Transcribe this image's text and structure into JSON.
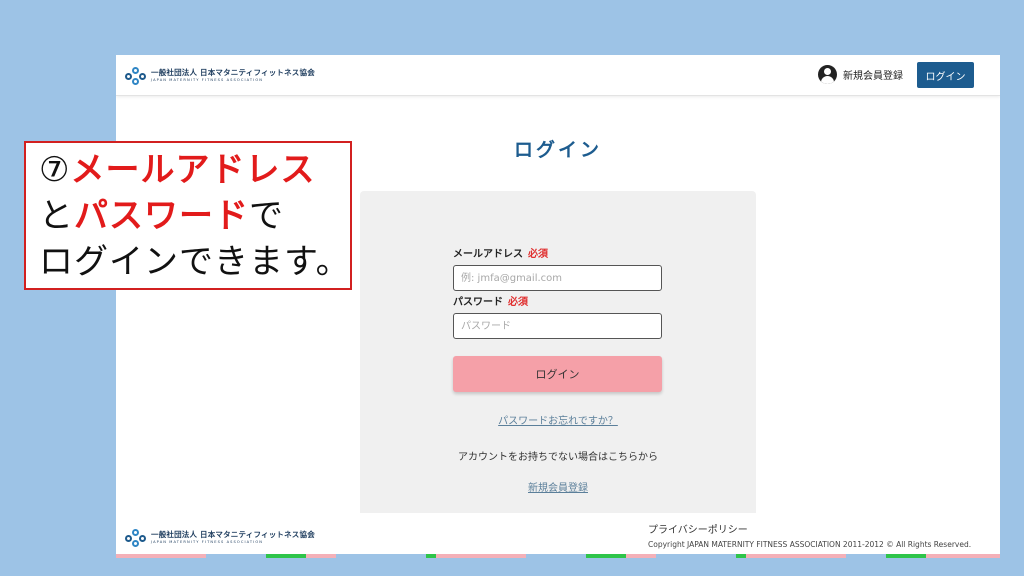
{
  "header": {
    "logo_jp": "一般社団法人 日本マタニティフィットネス協会",
    "logo_en": "JAPAN MATERNITY FITNESS ASSOCIATION",
    "register_label": "新規会員登録",
    "login_button": "ログイン"
  },
  "main": {
    "title": "ログイン",
    "email_label": "メールアドレス",
    "email_required": "必須",
    "email_placeholder": "例: jmfa@gmail.com",
    "password_label": "パスワード",
    "password_required": "必須",
    "password_placeholder": "パスワード",
    "submit_label": "ログイン",
    "forgot_link": "パスワードお忘れですか？",
    "no_account_text": "アカウントをお持ちでない場合はこちらから",
    "register_link": "新規会員登録"
  },
  "footer": {
    "logo_jp": "一般社団法人 日本マタニティフィットネス協会",
    "logo_en": "JAPAN MATERNITY FITNESS ASSOCIATION",
    "privacy_link": "プライバシーポリシー",
    "copyright": "Copyright JAPAN MATERNITY FITNESS ASSOCIATION 2011-2012 © All Rights Reserved."
  },
  "callout": {
    "number": "⑦",
    "highlight1": "メールアドレス",
    "text1": "と",
    "highlight2": "パスワード",
    "text2": "で",
    "text3": "ログインできます。"
  },
  "colors": {
    "background": "#9dc3e6",
    "accent": "#1d5c8f",
    "button_pink": "#f5a0a8",
    "required_red": "#e03030",
    "callout_red": "#e21b1b"
  }
}
